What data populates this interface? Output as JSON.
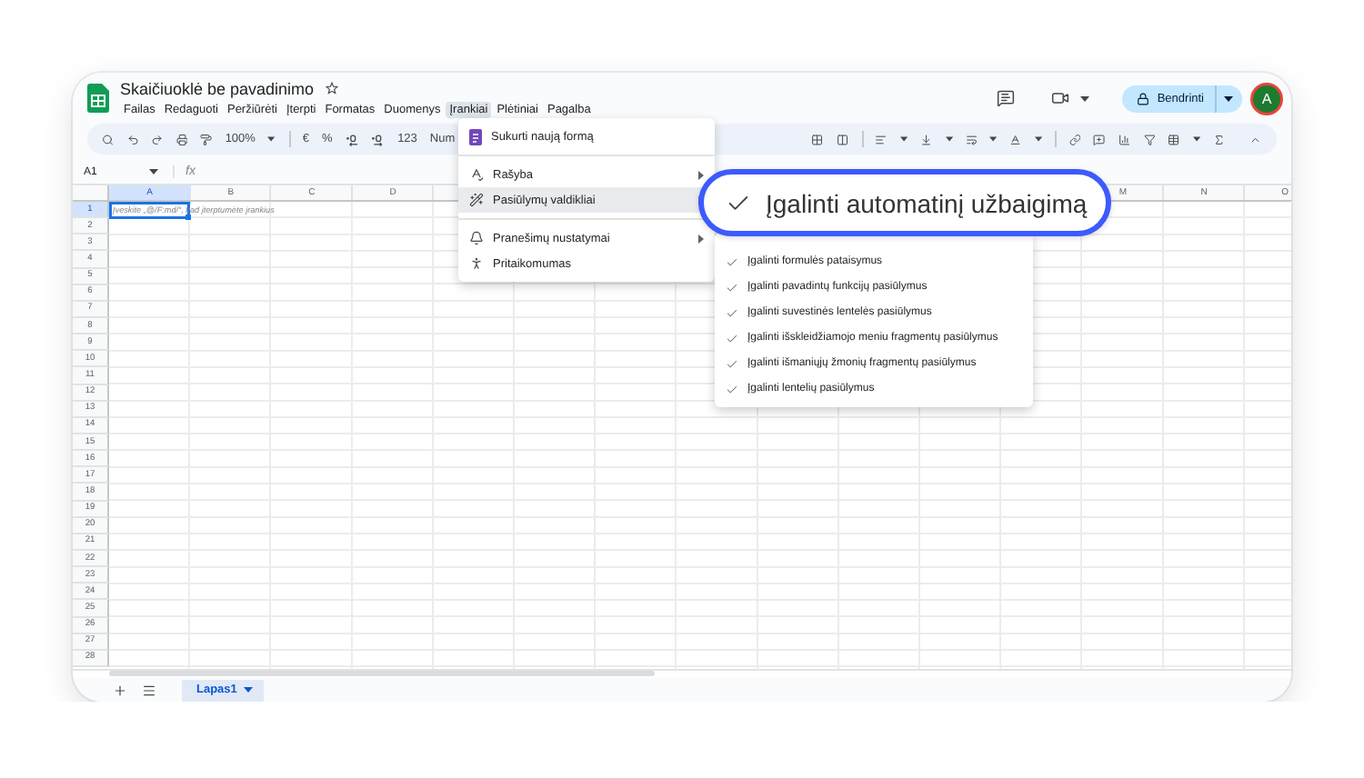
{
  "window": {
    "title": "Skaičiuoklė be pavadinimo"
  },
  "menu_bar": [
    {
      "label": "Failas",
      "selected": false
    },
    {
      "label": "Redaguoti",
      "selected": false
    },
    {
      "label": "Peržiūrėti",
      "selected": false
    },
    {
      "label": "Įterpti",
      "selected": false
    },
    {
      "label": "Formatas",
      "selected": false
    },
    {
      "label": "Duomenys",
      "selected": false
    },
    {
      "label": "Įrankiai",
      "selected": true
    },
    {
      "label": "Plėtiniai",
      "selected": false
    },
    {
      "label": "Pagalba",
      "selected": false
    }
  ],
  "header_actions": {
    "share_button": "Bendrinti",
    "avatar": "A"
  },
  "toolbar": {
    "zoom": "100%",
    "currency": "€",
    "percent": "%",
    "number_format": "123",
    "font_partial": "Num"
  },
  "formula_bar": {
    "name_box": "A1",
    "fx": "fx"
  },
  "sheet": {
    "columns_left": [
      {
        "label": "A",
        "selected": true
      },
      {
        "label": "B",
        "selected": false
      },
      {
        "label": "C",
        "selected": false
      },
      {
        "label": "D",
        "selected": false
      }
    ],
    "columns_right": [
      {
        "label": "M",
        "selected": false
      },
      {
        "label": "N",
        "selected": false
      },
      {
        "label": "O",
        "selected": false
      }
    ],
    "rows": [
      {
        "label": "1",
        "selected": true
      },
      {
        "label": "2",
        "selected": false
      },
      {
        "label": "3",
        "selected": false
      },
      {
        "label": "4",
        "selected": false
      },
      {
        "label": "5",
        "selected": false
      },
      {
        "label": "6",
        "selected": false
      },
      {
        "label": "7",
        "selected": false
      },
      {
        "label": "8",
        "selected": false
      },
      {
        "label": "9",
        "selected": false
      },
      {
        "label": "10",
        "selected": false
      },
      {
        "label": "11",
        "selected": false
      },
      {
        "label": "12",
        "selected": false
      },
      {
        "label": "13",
        "selected": false
      },
      {
        "label": "14",
        "selected": false
      },
      {
        "label": "15",
        "selected": false
      },
      {
        "label": "16",
        "selected": false
      },
      {
        "label": "17",
        "selected": false
      },
      {
        "label": "18",
        "selected": false
      },
      {
        "label": "19",
        "selected": false
      },
      {
        "label": "20",
        "selected": false
      },
      {
        "label": "21",
        "selected": false
      },
      {
        "label": "22",
        "selected": false
      },
      {
        "label": "23",
        "selected": false
      },
      {
        "label": "24",
        "selected": false
      },
      {
        "label": "25",
        "selected": false
      },
      {
        "label": "26",
        "selected": false
      },
      {
        "label": "27",
        "selected": false
      },
      {
        "label": "28",
        "selected": false
      }
    ],
    "cell_hint": "Įveskite „@/F:md/“, kad įterptumėte įrankius"
  },
  "tools_menu": [
    {
      "kind": "item",
      "label": "Sukurti naują formą",
      "has_submenu": false,
      "selected": false
    },
    {
      "kind": "divider"
    },
    {
      "kind": "item",
      "label": "Rašyba",
      "has_submenu": true,
      "selected": false
    },
    {
      "kind": "item",
      "label": "Pasiūlymų valdikliai",
      "has_submenu": true,
      "selected": true
    },
    {
      "kind": "divider"
    },
    {
      "kind": "item",
      "label": "Pranešimų nustatymai",
      "has_submenu": true,
      "selected": false
    },
    {
      "kind": "item",
      "label": "Pritaikomumas",
      "has_submenu": false,
      "selected": false
    }
  ],
  "suggestions_submenu": {
    "highlighted": {
      "label": "Įgalinti automatinį užbaigimą",
      "checked": true
    },
    "items": [
      {
        "label": "Įgalinti formulės pataisymus",
        "checked": true
      },
      {
        "label": "Įgalinti pavadintų funkcijų pasiūlymus",
        "checked": true
      },
      {
        "label": "Įgalinti suvestinės lentelės pasiūlymus",
        "checked": true
      },
      {
        "label": "Įgalinti išskleidžiamojo meniu fragmentų pasiūlymus",
        "checked": true
      },
      {
        "label": "Įgalinti išmaniųjų žmonių fragmentų pasiūlymus",
        "checked": true
      },
      {
        "label": "Įgalinti lentelių pasiūlymus",
        "checked": true
      }
    ]
  },
  "sheet_tabs": [
    {
      "label": "Lapas1",
      "selected": true
    }
  ]
}
